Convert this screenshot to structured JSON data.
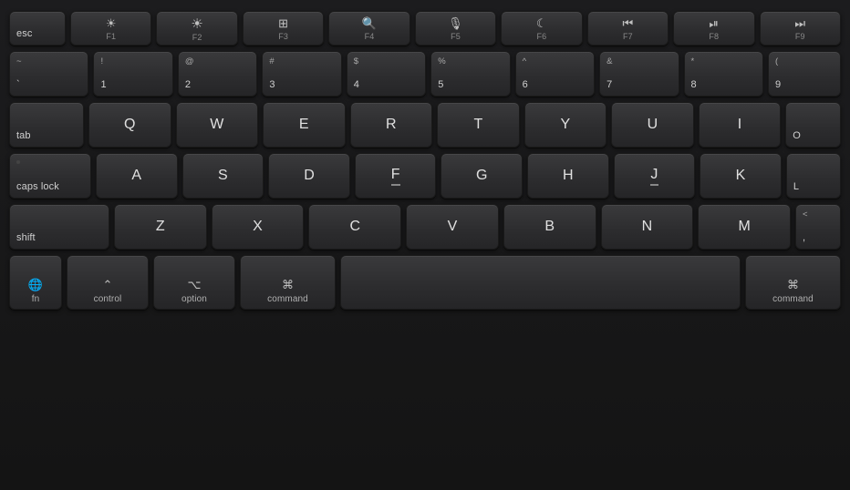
{
  "keyboard": {
    "bg_color": "#1a1a1a",
    "rows": {
      "row1": {
        "keys": [
          {
            "id": "esc",
            "label": "esc"
          },
          {
            "id": "f1",
            "icon": "☀",
            "sublabel": "F1"
          },
          {
            "id": "f2",
            "icon": "☀",
            "sublabel": "F2"
          },
          {
            "id": "f3",
            "icon": "⊞",
            "sublabel": "F3"
          },
          {
            "id": "f4",
            "icon": "⌕",
            "sublabel": "F4"
          },
          {
            "id": "f5",
            "icon": "🎙",
            "sublabel": "F5"
          },
          {
            "id": "f6",
            "icon": "☾",
            "sublabel": "F6"
          },
          {
            "id": "f7",
            "icon": "⏮",
            "sublabel": "F7"
          },
          {
            "id": "f8",
            "icon": "⏯",
            "sublabel": "F8"
          },
          {
            "id": "f9",
            "icon": "⏭",
            "sublabel": "F9"
          }
        ]
      },
      "row2": {
        "keys": [
          {
            "id": "tilde",
            "top": "~",
            "label": "`"
          },
          {
            "id": "1",
            "top": "!",
            "label": "1"
          },
          {
            "id": "2",
            "top": "@",
            "label": "2"
          },
          {
            "id": "3",
            "top": "#",
            "label": "3"
          },
          {
            "id": "4",
            "top": "$",
            "label": "4"
          },
          {
            "id": "5",
            "top": "%",
            "label": "5"
          },
          {
            "id": "6",
            "top": "^",
            "label": "6"
          },
          {
            "id": "7",
            "top": "&",
            "label": "7"
          },
          {
            "id": "8",
            "top": "*",
            "label": "8"
          },
          {
            "id": "9",
            "top": "(",
            "label": "9"
          }
        ]
      },
      "row3": {
        "keys": [
          {
            "id": "tab",
            "label": "tab"
          },
          {
            "id": "q",
            "label": "Q"
          },
          {
            "id": "w",
            "label": "W"
          },
          {
            "id": "e",
            "label": "E"
          },
          {
            "id": "r",
            "label": "R"
          },
          {
            "id": "t",
            "label": "T"
          },
          {
            "id": "y",
            "label": "Y"
          },
          {
            "id": "u",
            "label": "U"
          },
          {
            "id": "i",
            "label": "I"
          },
          {
            "id": "o",
            "label": "O"
          }
        ]
      },
      "row4": {
        "keys": [
          {
            "id": "caps",
            "label": "caps lock"
          },
          {
            "id": "a",
            "label": "A"
          },
          {
            "id": "s",
            "label": "S"
          },
          {
            "id": "d",
            "label": "D"
          },
          {
            "id": "f",
            "label": "F"
          },
          {
            "id": "g",
            "label": "G"
          },
          {
            "id": "h",
            "label": "H"
          },
          {
            "id": "j",
            "label": "J"
          },
          {
            "id": "k",
            "label": "K"
          },
          {
            "id": "l",
            "label": "L"
          }
        ]
      },
      "row5": {
        "keys": [
          {
            "id": "shift",
            "label": "shift"
          },
          {
            "id": "z",
            "label": "Z"
          },
          {
            "id": "x",
            "label": "X"
          },
          {
            "id": "c",
            "label": "C"
          },
          {
            "id": "v",
            "label": "V"
          },
          {
            "id": "b",
            "label": "B"
          },
          {
            "id": "n",
            "label": "N"
          },
          {
            "id": "m",
            "label": "M"
          },
          {
            "id": "comma",
            "top": "<",
            "label": ","
          }
        ]
      },
      "row6": {
        "fn_label": "fn",
        "globe_icon": "🌐",
        "control_icon": "⌃",
        "control_label": "control",
        "option_icon": "⌥",
        "option_label": "option",
        "command_icon": "⌘",
        "command_left_label": "command",
        "space_label": "",
        "command_right_label": "command"
      }
    }
  }
}
